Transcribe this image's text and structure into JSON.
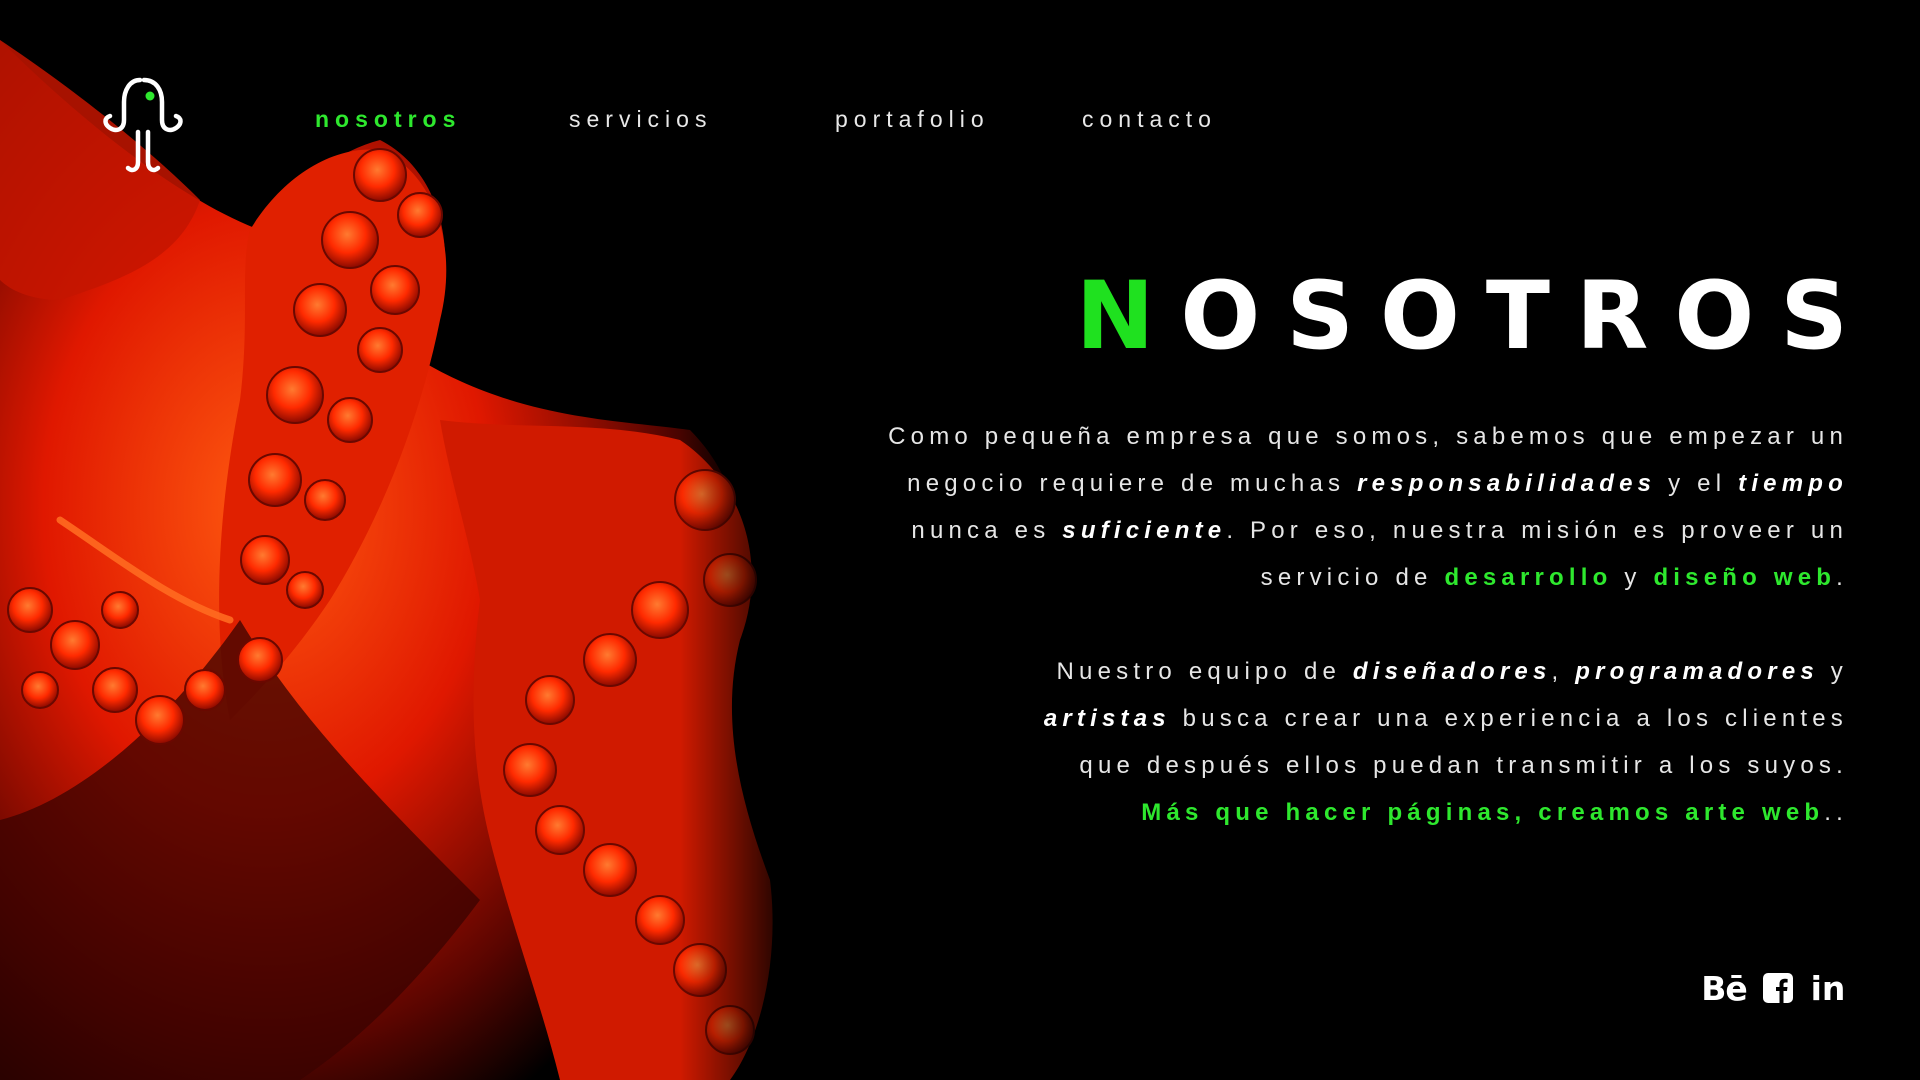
{
  "nav": {
    "items": [
      {
        "label": "nosotros",
        "active": true
      },
      {
        "label": "servicios",
        "active": false
      },
      {
        "label": "portafolio",
        "active": false
      },
      {
        "label": "contacto",
        "active": false
      }
    ]
  },
  "headline": {
    "first_letter": "N",
    "rest": "OSOTROS"
  },
  "paragraph1": {
    "l1": "Como pequeña empresa que somos, sabemos que empezar un",
    "l2a": "negocio requiere de muchas ",
    "l2b": "responsabilidades",
    "l2c": " y el ",
    "l2d": "tiempo",
    "l3a": "nunca es ",
    "l3b": "suficiente",
    "l3c": ". Por eso, nuestra misión es proveer un",
    "l4a": "servicio de ",
    "l4b": "desarrollo",
    "l4c": " y ",
    "l4d": "diseño web",
    "l4e": "."
  },
  "paragraph2": {
    "l1a": "Nuestro equipo de ",
    "l1b": "diseñadores",
    "l1c": ", ",
    "l1d": "programadores",
    "l1e": " y",
    "l2a": "artistas",
    "l2b": " busca crear una experiencia a los clientes",
    "l3": "que después ellos puedan transmitir a los suyos.",
    "l4a": "Más que hacer páginas, creamos arte web",
    "l4b": ".."
  },
  "social": {
    "behance": "Bē",
    "facebook": "f",
    "linkedin": "in"
  },
  "icons": [
    "octopus-logo-icon",
    "behance-icon",
    "facebook-icon",
    "linkedin-icon"
  ],
  "colors": {
    "accent": "#2ee82e",
    "background": "#000000",
    "text": "#e6e6e6",
    "octopus": "#ff2a00"
  }
}
